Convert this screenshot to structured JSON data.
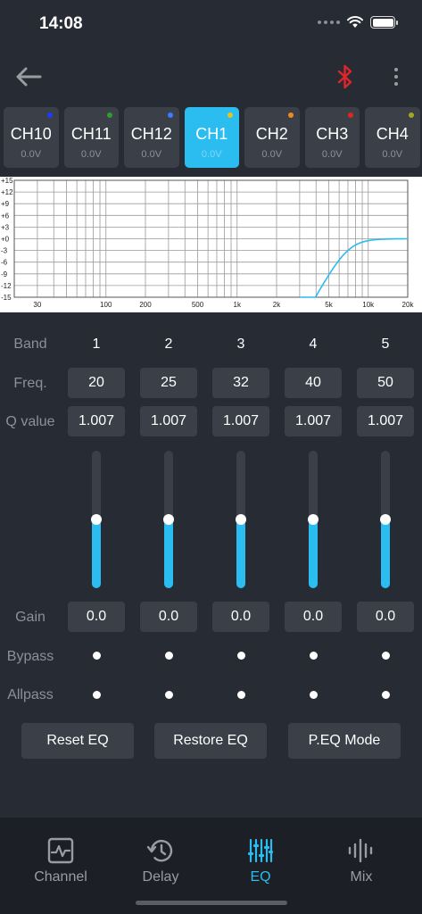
{
  "status_bar": {
    "time": "14:08"
  },
  "colors": {
    "accent": "#2bbcf0",
    "bluetooth": "#e0242b",
    "panel": "#3a3f48",
    "background": "#272b33"
  },
  "channels": [
    {
      "name": "CH10",
      "voltage": "0.0V",
      "dot_color": "#1a3cff",
      "active": false
    },
    {
      "name": "CH11",
      "voltage": "0.0V",
      "dot_color": "#2d9e2d",
      "active": false
    },
    {
      "name": "CH12",
      "voltage": "0.0V",
      "dot_color": "#3a7bff",
      "active": false
    },
    {
      "name": "CH1",
      "voltage": "0.0V",
      "dot_color": "#e5c51a",
      "active": true
    },
    {
      "name": "CH2",
      "voltage": "0.0V",
      "dot_color": "#f08a1e",
      "active": false
    },
    {
      "name": "CH3",
      "voltage": "0.0V",
      "dot_color": "#e02424",
      "active": false
    },
    {
      "name": "CH4",
      "voltage": "0.0V",
      "dot_color": "#a3a81c",
      "active": false
    }
  ],
  "graph": {
    "y_labels": [
      "+15",
      "+12",
      "+9",
      "+6",
      "+3",
      "+0",
      "-3",
      "-6",
      "-9",
      "-12",
      "-15"
    ],
    "x_labels": [
      "30",
      "100",
      "200",
      "500",
      "1k",
      "2k",
      "5k",
      "10k",
      "20k"
    ]
  },
  "eq": {
    "labels": {
      "band": "Band",
      "freq": "Freq.",
      "q": "Q value",
      "gain": "Gain",
      "bypass": "Bypass",
      "allpass": "Allpass"
    },
    "bands": [
      {
        "number": "1",
        "freq": "20",
        "q": "1.007",
        "gain": "0.0",
        "level": 0.5
      },
      {
        "number": "2",
        "freq": "25",
        "q": "1.007",
        "gain": "0.0",
        "level": 0.5
      },
      {
        "number": "3",
        "freq": "32",
        "q": "1.007",
        "gain": "0.0",
        "level": 0.5
      },
      {
        "number": "4",
        "freq": "40",
        "q": "1.007",
        "gain": "0.0",
        "level": 0.5
      },
      {
        "number": "5",
        "freq": "50",
        "q": "1.007",
        "gain": "0.0",
        "level": 0.5
      }
    ]
  },
  "actions": {
    "reset": "Reset EQ",
    "restore": "Restore EQ",
    "mode": "P.EQ Mode"
  },
  "tabs": [
    {
      "label": "Channel",
      "icon": "channel-icon",
      "active": false
    },
    {
      "label": "Delay",
      "icon": "delay-icon",
      "active": false
    },
    {
      "label": "EQ",
      "icon": "eq-icon",
      "active": true
    },
    {
      "label": "Mix",
      "icon": "mix-icon",
      "active": false
    }
  ]
}
